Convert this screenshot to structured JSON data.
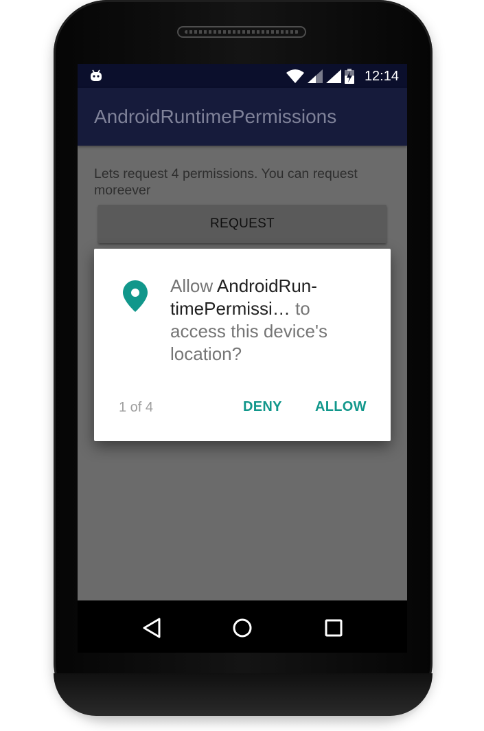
{
  "status_bar": {
    "time": "12:14",
    "icons": [
      "android-debug-icon",
      "wifi-icon",
      "signal-icon",
      "signal-icon",
      "battery-charging-icon"
    ]
  },
  "app_bar": {
    "title": "AndroidRuntimePermissions"
  },
  "content": {
    "intro_text": "Lets request 4 permissions. You can request moreever",
    "request_button_label": "REQUEST"
  },
  "dialog": {
    "icon": "location-pin-icon",
    "message_prefix": "Allow ",
    "app_name": "AndroidRun-timePermissi…",
    "message_suffix": " to access this device's location?",
    "counter": "1 of 4",
    "deny_label": "DENY",
    "allow_label": "ALLOW",
    "accent_color": "#11978b"
  },
  "nav_bar": {
    "icons": [
      "back-icon",
      "home-icon",
      "recents-icon"
    ]
  },
  "colors": {
    "status_bar": "#0b0f2c",
    "app_bar": "#161b3b",
    "scrim_background": "#6b6b6b"
  }
}
